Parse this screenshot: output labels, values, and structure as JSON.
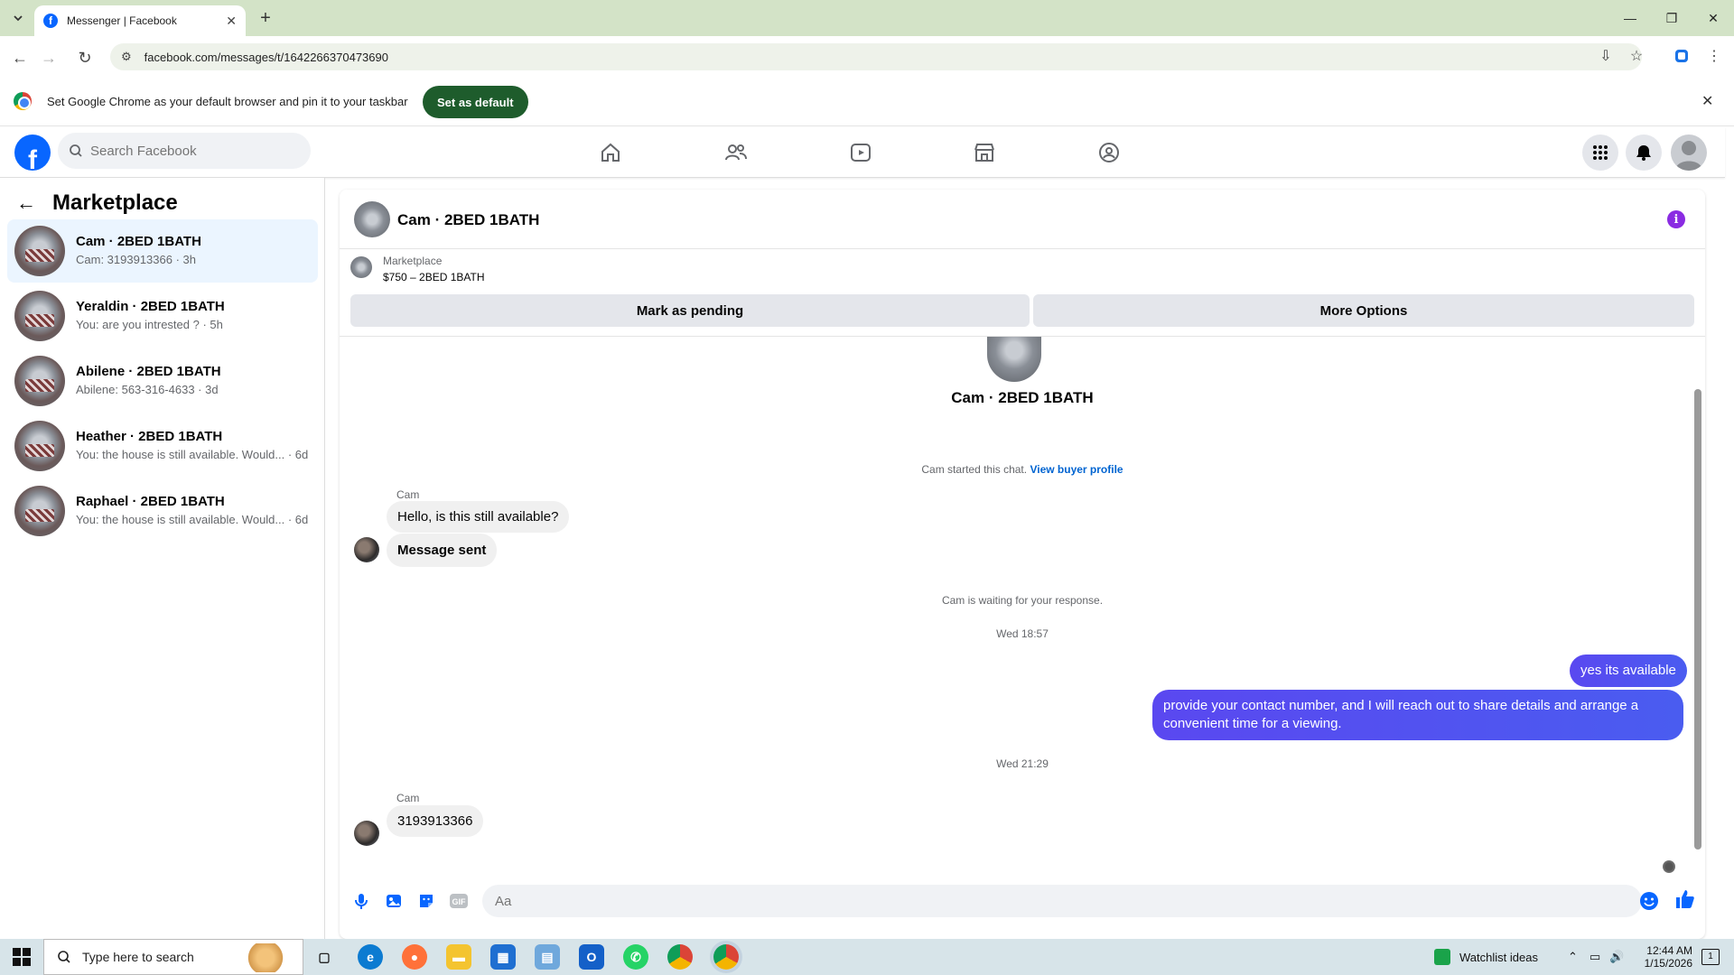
{
  "browser": {
    "tab_title": "Messenger | Facebook",
    "url": "facebook.com/messages/t/1642266370473690",
    "infobar_message": "Set Google Chrome as your default browser and pin it to your taskbar",
    "set_default_label": "Set as default"
  },
  "facebook": {
    "search_placeholder": "Search Facebook"
  },
  "sidebar": {
    "title": "Marketplace",
    "conversations": [
      {
        "name": "Cam · 2BED 1BATH",
        "preview": "Cam: 3193913366 · 3h",
        "active": true
      },
      {
        "name": "Yeraldin · 2BED 1BATH",
        "preview": "You: are you intrested ? · 5h",
        "active": false
      },
      {
        "name": "Abilene · 2BED 1BATH",
        "preview": "Abilene: 563-316-4633 · 3d",
        "active": false
      },
      {
        "name": "Heather · 2BED 1BATH",
        "preview": "You: the house is still available. Would... · 6d",
        "active": false
      },
      {
        "name": "Raphael · 2BED 1BATH",
        "preview": "You: the house is still available. Would... · 6d",
        "active": false
      }
    ]
  },
  "chat": {
    "header_name": "Cam · 2BED 1BATH",
    "listing_source": "Marketplace",
    "listing_title": "$750 – 2BED 1BATH",
    "mark_pending_label": "Mark as pending",
    "more_options_label": "More Options",
    "intro_name": "Cam · 2BED 1BATH",
    "started_text": "Cam started this chat.",
    "view_buyer_label": "View buyer profile",
    "sender_1": "Cam",
    "msg_1": "Hello, is this still available?",
    "msg_2": "Message sent",
    "waiting_text": "Cam is waiting for your response.",
    "time_1": "Wed 18:57",
    "out_1": "yes its available",
    "out_2": "provide your contact number, and I will reach out to share  details and arrange a convenient time for a viewing.",
    "time_2": "Wed 21:29",
    "sender_2": "Cam",
    "msg_3": "3193913366",
    "composer_placeholder": "Aa"
  },
  "taskbar": {
    "search_text": "Type here to search",
    "widget": "Watchlist ideas",
    "time": "12:44 AM",
    "date": "1/15/2026",
    "notif_count": "1"
  },
  "colors": {
    "fb_blue": "#0866ff",
    "bubble_out": "#5a48f0",
    "active_row": "#ebf5ff",
    "set_default_bg": "#1e5c2c",
    "info_icon": "#8a2be2"
  }
}
